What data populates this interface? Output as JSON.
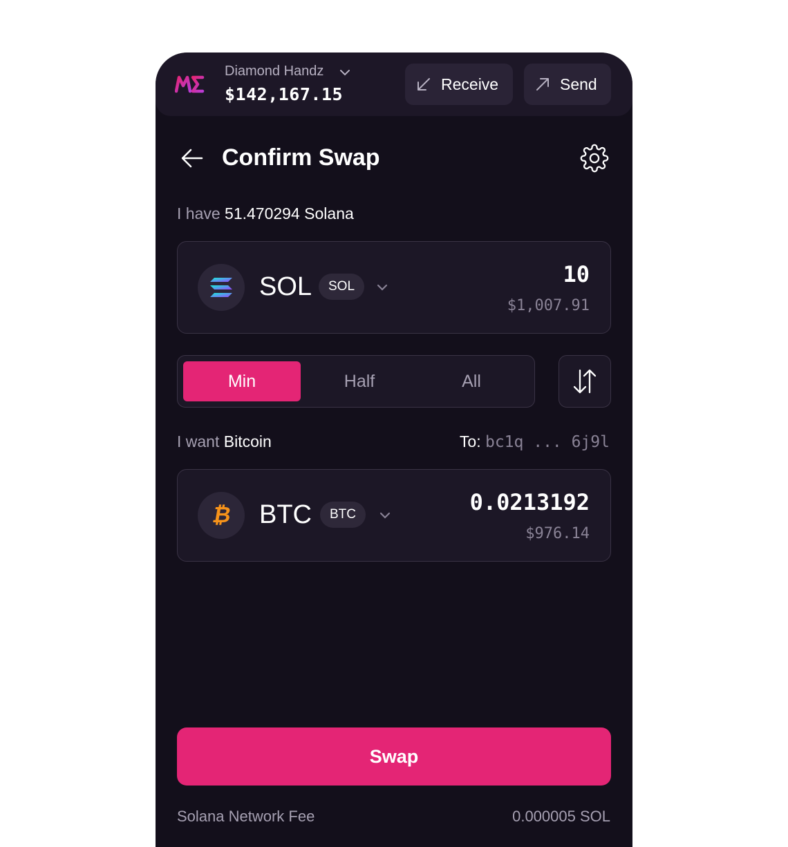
{
  "header": {
    "account_name": "Diamond Handz",
    "balance": "$142,167.15",
    "receive_label": "Receive",
    "send_label": "Send"
  },
  "page": {
    "title": "Confirm Swap"
  },
  "from": {
    "have_prefix": "I have",
    "have_amount": "51.470294 Solana",
    "token_name": "SOL",
    "token_symbol": "SOL",
    "amount": "10",
    "usd_value": "$1,007.91"
  },
  "amount_presets": {
    "options": [
      "Min",
      "Half",
      "All"
    ],
    "selected": "Min"
  },
  "to": {
    "want_prefix": "I want",
    "want_asset": "Bitcoin",
    "to_label": "To:",
    "address": "bc1q ... 6j9l",
    "token_name": "BTC",
    "token_symbol": "BTC",
    "amount": "0.0213192",
    "usd_value": "$976.14"
  },
  "actions": {
    "swap_label": "Swap"
  },
  "fee": {
    "label": "Solana Network Fee",
    "value": "0.000005 SOL"
  },
  "colors": {
    "background": "#130f1b",
    "accent": "#e42575",
    "card": "#1c1726",
    "muted_text": "#a6a0b2"
  },
  "icons": [
    "magic-eden-logo-icon",
    "chevron-down-icon",
    "receive-arrow-icon",
    "send-arrow-icon",
    "back-arrow-icon",
    "gear-icon",
    "solana-icon",
    "bitcoin-icon",
    "swap-direction-icon"
  ]
}
